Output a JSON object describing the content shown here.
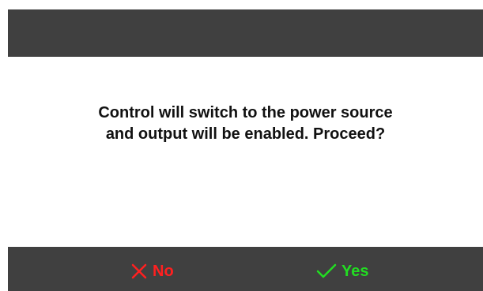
{
  "dialog": {
    "message_line1": "Control will switch to the power source",
    "message_line2": "and output will be enabled. Proceed?"
  },
  "buttons": {
    "no_label": "No",
    "yes_label": "Yes",
    "no_icon": "close-icon",
    "yes_icon": "checkmark-icon"
  },
  "colors": {
    "bar_background": "#404040",
    "no_color": "#ff2020",
    "yes_color": "#22dd22"
  }
}
